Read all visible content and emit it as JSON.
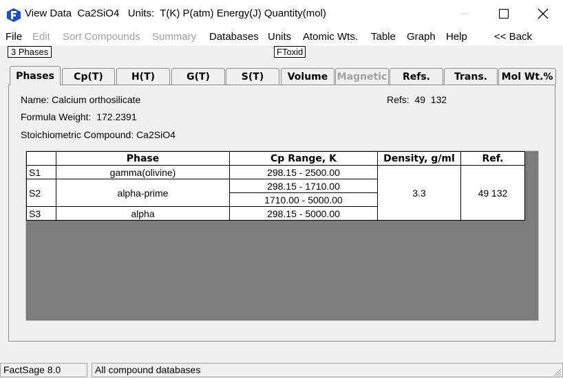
{
  "window": {
    "title": "View Data  Ca2SiO4   Units:  T(K) P(atm) Energy(J) Quantity(mol)"
  },
  "menu": {
    "items": [
      "File",
      "Edit",
      "Sort Compounds",
      "Summary",
      "Databases",
      "Units",
      "Atomic Wts.",
      "Table",
      "Graph",
      "Help",
      "<< Back"
    ],
    "disabled": [
      "Edit",
      "Sort Compounds",
      "Summary"
    ]
  },
  "toolbar": {
    "phases_count": "3 Phases",
    "database": "FToxid"
  },
  "tabs": [
    {
      "label": "Phases",
      "active": true,
      "disabled": false
    },
    {
      "label": "Cp(T)",
      "active": false,
      "disabled": false
    },
    {
      "label": "H(T)",
      "active": false,
      "disabled": false
    },
    {
      "label": "G(T)",
      "active": false,
      "disabled": false
    },
    {
      "label": "S(T)",
      "active": false,
      "disabled": false
    },
    {
      "label": "Volume",
      "active": false,
      "disabled": false
    },
    {
      "label": "Magnetic",
      "active": false,
      "disabled": true
    },
    {
      "label": "Refs.",
      "active": false,
      "disabled": false
    },
    {
      "label": "Trans.",
      "active": false,
      "disabled": false
    },
    {
      "label": "Mol Wt.%",
      "active": false,
      "disabled": false
    }
  ],
  "info": {
    "name": "Name: Calcium orthosilicate",
    "formula_weight": "Formula Weight:  172.2391",
    "stoichiometric": "Stoichiometric Compound: Ca2SiO4",
    "refs": "Refs:  49  132"
  },
  "table": {
    "headers": {
      "phase": "Phase",
      "cp_range": "Cp Range, K",
      "density": "Density, g/ml",
      "ref": "Ref."
    },
    "rows": [
      {
        "id": "S1",
        "phase": "gamma(olivine)",
        "ranges": [
          "298.15 - 2500.00"
        ]
      },
      {
        "id": "S2",
        "phase": "alpha-prime",
        "ranges": [
          "298.15 - 1710.00",
          "1710.00 - 5000.00"
        ]
      },
      {
        "id": "S3",
        "phase": "alpha",
        "ranges": [
          "298.15 - 5000.00"
        ]
      }
    ],
    "density": "3.3",
    "ref": "49  132"
  },
  "status": {
    "version": "FactSage 8.0",
    "message": "All compound databases"
  },
  "colors": {
    "brand": "#1a50c8",
    "grid_background": "#7c7c7c"
  }
}
